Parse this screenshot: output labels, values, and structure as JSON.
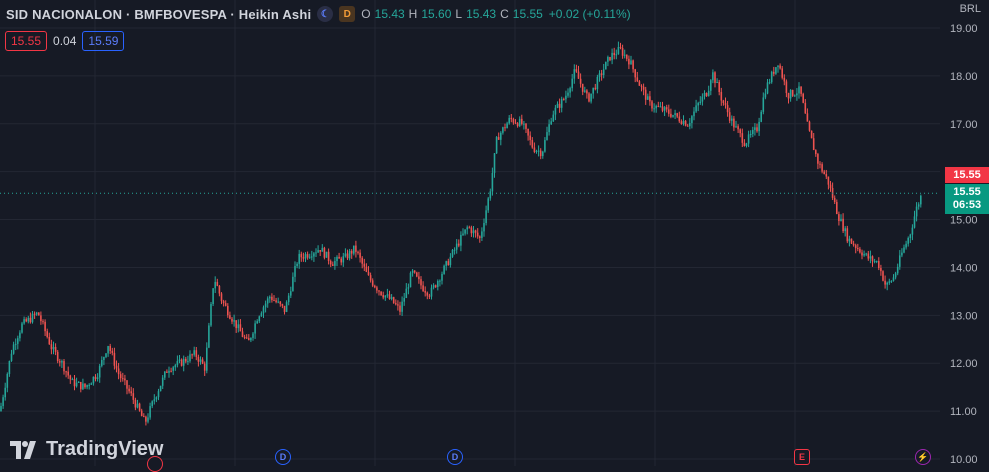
{
  "header": {
    "symbol": "SID NACIONALON · BMFBOVESPA · Heikin Ashi",
    "badge_moon": "☾",
    "badge_d": "D",
    "o_label": "O",
    "o_val": "15.43",
    "h_label": "H",
    "h_val": "15.60",
    "l_label": "L",
    "l_val": "15.43",
    "c_label": "C",
    "c_val": "15.55",
    "change": "+0.02 (+0.11%)"
  },
  "trade": {
    "sell": "15.55",
    "spread": "0.04",
    "buy": "15.59"
  },
  "currency": "BRL",
  "price_tags": {
    "last": "15.55",
    "close": "15.55",
    "timer": "06:53"
  },
  "brand": "TradingView",
  "events": [
    {
      "glyph": "D",
      "kind": "dividend"
    },
    {
      "glyph": "D",
      "kind": "dividend"
    },
    {
      "glyph": "E",
      "kind": "earnings"
    },
    {
      "glyph": "⚡",
      "kind": "split"
    }
  ],
  "colors": {
    "up": "#26a69a",
    "down": "#ef5350",
    "background": "#161a25",
    "grid": "#232733"
  },
  "chart_data": {
    "type": "candlestick",
    "style": "Heikin Ashi",
    "ylabel": "BRL",
    "ylim": [
      10,
      19.3
    ],
    "y_ticks": [
      "19.00",
      "18.00",
      "17.00",
      "16.00",
      "15.00",
      "14.00",
      "13.00",
      "12.00",
      "11.00",
      "10.00"
    ],
    "grid": true,
    "last_price": 15.55,
    "close_path": [
      [
        0,
        11.0
      ],
      [
        12,
        12.3
      ],
      [
        22,
        12.8
      ],
      [
        38,
        13.05
      ],
      [
        52,
        12.3
      ],
      [
        62,
        12.0
      ],
      [
        72,
        11.6
      ],
      [
        85,
        11.5
      ],
      [
        98,
        11.8
      ],
      [
        108,
        12.4
      ],
      [
        118,
        11.8
      ],
      [
        132,
        11.3
      ],
      [
        145,
        10.75
      ],
      [
        155,
        11.3
      ],
      [
        168,
        11.9
      ],
      [
        180,
        12.0
      ],
      [
        195,
        12.2
      ],
      [
        205,
        11.9
      ],
      [
        214,
        13.8
      ],
      [
        222,
        13.3
      ],
      [
        236,
        12.8
      ],
      [
        248,
        12.4
      ],
      [
        258,
        13.0
      ],
      [
        270,
        13.4
      ],
      [
        285,
        13.1
      ],
      [
        298,
        14.2
      ],
      [
        310,
        14.3
      ],
      [
        320,
        14.4
      ],
      [
        332,
        14.1
      ],
      [
        345,
        14.2
      ],
      [
        355,
        14.4
      ],
      [
        368,
        13.8
      ],
      [
        380,
        13.5
      ],
      [
        392,
        13.3
      ],
      [
        400,
        13.1
      ],
      [
        412,
        13.9
      ],
      [
        422,
        13.6
      ],
      [
        430,
        13.45
      ],
      [
        445,
        14.0
      ],
      [
        458,
        14.5
      ],
      [
        468,
        14.85
      ],
      [
        480,
        14.6
      ],
      [
        490,
        15.6
      ],
      [
        497,
        16.7
      ],
      [
        510,
        17.1
      ],
      [
        522,
        17.0
      ],
      [
        533,
        16.5
      ],
      [
        542,
        16.4
      ],
      [
        552,
        17.2
      ],
      [
        565,
        17.55
      ],
      [
        575,
        18.1
      ],
      [
        588,
        17.5
      ],
      [
        600,
        18.0
      ],
      [
        610,
        18.4
      ],
      [
        620,
        18.55
      ],
      [
        630,
        18.3
      ],
      [
        640,
        17.8
      ],
      [
        650,
        17.4
      ],
      [
        662,
        17.3
      ],
      [
        672,
        17.2
      ],
      [
        688,
        17.0
      ],
      [
        698,
        17.4
      ],
      [
        708,
        17.7
      ],
      [
        712,
        18.1
      ],
      [
        722,
        17.5
      ],
      [
        733,
        17.0
      ],
      [
        745,
        16.6
      ],
      [
        757,
        16.9
      ],
      [
        765,
        17.7
      ],
      [
        778,
        18.3
      ],
      [
        788,
        17.6
      ],
      [
        800,
        17.7
      ],
      [
        808,
        16.9
      ],
      [
        818,
        16.2
      ],
      [
        828,
        15.8
      ],
      [
        838,
        15.1
      ],
      [
        848,
        14.6
      ],
      [
        858,
        14.4
      ],
      [
        868,
        14.2
      ],
      [
        878,
        14.1
      ],
      [
        886,
        13.6
      ],
      [
        894,
        13.8
      ],
      [
        902,
        14.3
      ],
      [
        910,
        14.7
      ],
      [
        916,
        15.2
      ],
      [
        922,
        15.55
      ]
    ]
  }
}
